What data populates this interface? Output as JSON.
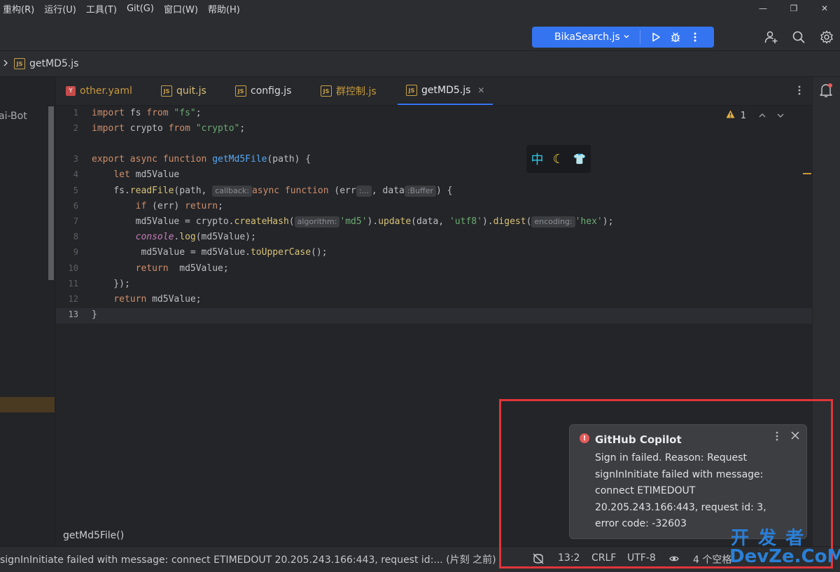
{
  "menu": [
    "重构(R)",
    "运行(U)",
    "工具(T)",
    "Git(G)",
    "窗口(W)",
    "帮助(H)"
  ],
  "window_controls": {
    "minimize": "—",
    "restore": "❐",
    "close": "✕"
  },
  "run_config": {
    "name": "BikaSearch.js"
  },
  "breadcrumb": {
    "file": "getMD5.js"
  },
  "left_panel": {
    "label": "ai-Bot"
  },
  "tabs": [
    {
      "label": "other.yaml",
      "type": "yaml",
      "color": "#c79a3e"
    },
    {
      "label": "quit.js",
      "type": "js",
      "color": "#d9bf7a"
    },
    {
      "label": "config.js",
      "type": "js",
      "color": "#d6d8dc"
    },
    {
      "label": "群控制.js",
      "type": "js",
      "color": "#c79a3e"
    },
    {
      "label": "getMD5.js",
      "type": "js",
      "color": "#e4e6ea",
      "active": true
    }
  ],
  "editor": {
    "line_numbers": [
      "1",
      "2",
      "3",
      "4",
      "5",
      "6",
      "7",
      "8",
      "9",
      "10",
      "11",
      "12",
      "13"
    ],
    "inspection_count": "1",
    "hints": {
      "callback": "callback:",
      "err": ":...",
      "buffer": ":Buffer",
      "algorithm": "algorithm:",
      "encoding": "encoding:"
    }
  },
  "floating_toolbar": [
    "中",
    "☾",
    "👕"
  ],
  "nav_path": "getMd5File()",
  "status": {
    "message": "signInInitiate failed with message: connect ETIMEDOUT 20.205.243.166:443, request id:... (片刻 之前)",
    "position": "13:2",
    "line_sep": "CRLF",
    "encoding": "UTF-8",
    "indent": "4 个空格"
  },
  "notification": {
    "title": "GitHub Copilot",
    "body": "Sign in failed. Reason: Request signInInitiate failed with message: connect ETIMEDOUT 20.205.243.166:443, request id: 3, error code: -32603"
  },
  "watermark": {
    "line1": "开 发 者",
    "line2": "DevZe.CoM"
  },
  "colors": {
    "accent": "#3574f0",
    "highlight_frame": "#e0353a"
  }
}
